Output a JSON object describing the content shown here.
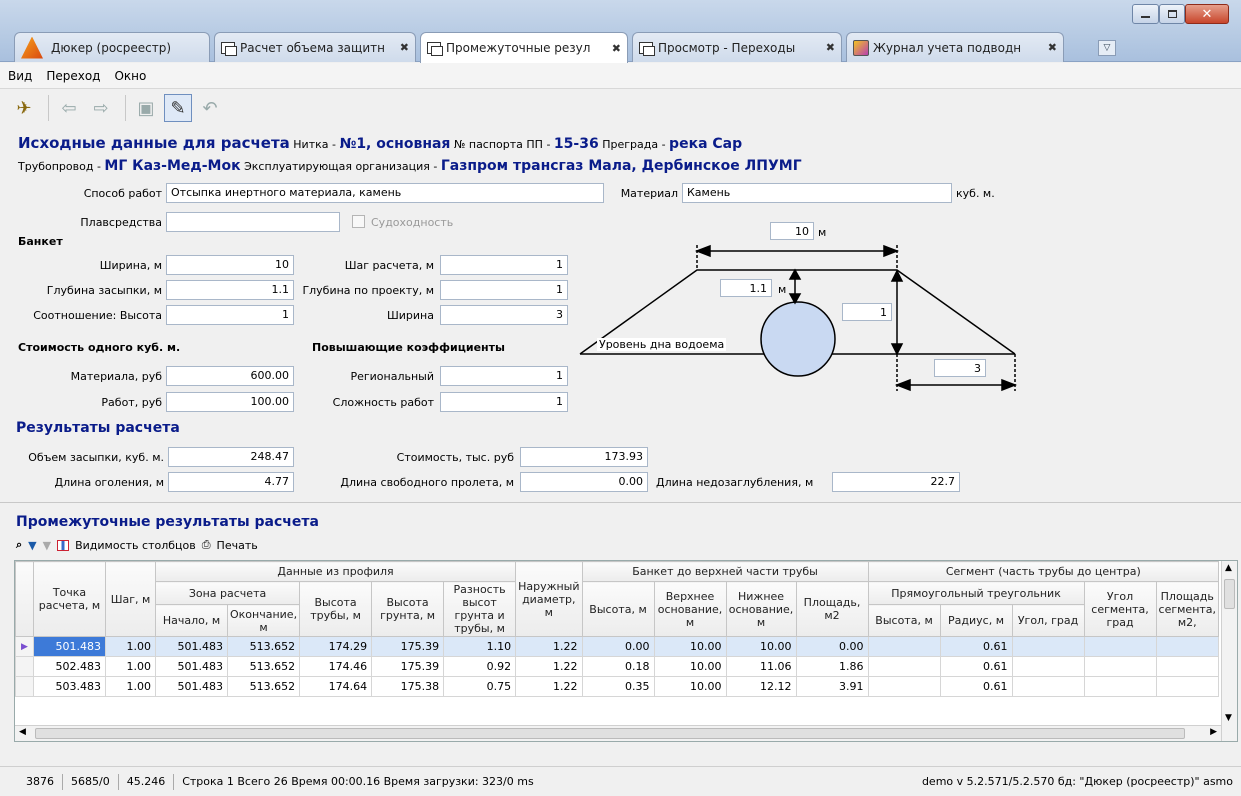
{
  "tabs": [
    {
      "label": "Дюкер (росреестр)",
      "icon": "app-logo-icon"
    },
    {
      "label": "Расчет объема защитн",
      "icon": "document-icon"
    },
    {
      "label": "Промежуточные резул",
      "icon": "document-icon"
    },
    {
      "label": "Просмотр - Переходы",
      "icon": "document-icon"
    },
    {
      "label": "Журнал учета подводн",
      "icon": "journal-icon"
    }
  ],
  "menu": [
    "Вид",
    "Переход",
    "Окно"
  ],
  "header": {
    "title": "Исходные данные для расчета",
    "nitka_label": "Нитка -",
    "nitka_value": "№1, основная",
    "passport_label": "№ паспорта ПП -",
    "passport_value": "15-36",
    "pregrada_label": "Преграда -",
    "pregrada_value": "река Сар",
    "pipeline_label": "Трубопровод -",
    "pipeline_value": "МГ Каз-Мед-Мок",
    "org_label": "Эксплуатирующая организация -",
    "org_value": "Газпром трансгаз Мала, Дербинское ЛПУМГ"
  },
  "form": {
    "method_label": "Способ работ",
    "method_value": "Отсыпка инертного материала, камень",
    "material_label": "Материал",
    "material_value": "Камень",
    "material_unit": "куб. м.",
    "vessel_label": "Плавсредства",
    "vessel_value": "",
    "navigable_label": "Судоходность",
    "banket_label": "Банкет",
    "width_label": "Ширина, м",
    "width_value": "10",
    "step_label": "Шаг расчета, м",
    "step_value": "1",
    "depth_label": "Глубина засыпки, м",
    "depth_value": "1.1",
    "design_depth_label": "Глубина по проекту, м",
    "design_depth_value": "1",
    "ratio_label": "Соотношение: Высота",
    "ratio_value": "1",
    "ratio_width_label": "Ширина",
    "ratio_width_value": "3",
    "cost_header": "Стоимость одного куб. м.",
    "coef_header": "Повышающие коэффициенты",
    "mat_cost_label": "Материала, руб",
    "mat_cost_value": "600.00",
    "regional_label": "Региональный",
    "regional_value": "1",
    "work_cost_label": "Работ, руб",
    "work_cost_value": "100.00",
    "complexity_label": "Сложность работ",
    "complexity_value": "1"
  },
  "diagram": {
    "top_width": "10",
    "top_unit": "м",
    "depth": "1.1",
    "depth_unit": "м",
    "height": "1",
    "bottom_label": "Уровень дна водоема",
    "slope": "3"
  },
  "results": {
    "title": "Результаты расчета",
    "volume_label": "Объем засыпки, куб. м.",
    "volume_value": "248.47",
    "cost_label": "Стоимость, тыс. руб",
    "cost_value": "173.93",
    "exposure_label": "Длина оголения, м",
    "exposure_value": "4.77",
    "span_label": "Длина свободного пролета, м",
    "span_value": "0.00",
    "shallow_label": "Длина недозаглубления, м",
    "shallow_value": "22.7"
  },
  "intermediate": {
    "title": "Промежуточные результаты расчета",
    "visibility_label": "Видимость столбцов",
    "print_label": "Печать"
  },
  "grid": {
    "group_headers": {
      "profile": "Данные из профиля",
      "banket": "Банкет до верхней части трубы",
      "segment": "Сегмент (часть трубы до центра)",
      "zone": "Зона расчета",
      "triangle": "Прямоугольный треугольник"
    },
    "columns": {
      "point": "Точка расчета, м",
      "step": "Шаг, м",
      "start": "Начало, м",
      "end": "Окончание, м",
      "pipe_h": "Высота трубы, м",
      "ground_h": "Высота грунта, м",
      "diff": "Разность высот грунта и трубы, м",
      "diam": "Наружный диаметр, м",
      "b_height": "Высота, м",
      "b_top": "Верхнее основание, м",
      "b_bottom": "Нижнее основание, м",
      "b_area": "Площадь, м2",
      "t_height": "Высота, м",
      "t_radius": "Радиус, м",
      "t_angle": "Угол, град",
      "seg_angle": "Угол сегмента, град",
      "seg_area": "Площадь сегмента, м2,"
    },
    "rows": [
      [
        "501.483",
        "1.00",
        "501.483",
        "513.652",
        "174.29",
        "175.39",
        "1.10",
        "1.22",
        "0.00",
        "10.00",
        "10.00",
        "0.00",
        "",
        "0.61",
        "",
        "",
        ""
      ],
      [
        "502.483",
        "1.00",
        "501.483",
        "513.652",
        "174.46",
        "175.39",
        "0.92",
        "1.22",
        "0.18",
        "10.00",
        "11.06",
        "1.86",
        "",
        "0.61",
        "",
        "",
        ""
      ],
      [
        "503.483",
        "1.00",
        "501.483",
        "513.652",
        "174.64",
        "175.38",
        "0.75",
        "1.22",
        "0.35",
        "10.00",
        "12.12",
        "3.91",
        "",
        "0.61",
        "",
        "",
        ""
      ]
    ]
  },
  "status": {
    "s1": "3876",
    "s2": "5685/0",
    "s3": "45.246",
    "s4": "Строка 1 Всего 26 Время 00:00.16  Время загрузки: 323/0 ms",
    "s5": "demo  v 5.2.571/5.2.570  бд: \"Дюкер (росреестр)\" asmo"
  }
}
